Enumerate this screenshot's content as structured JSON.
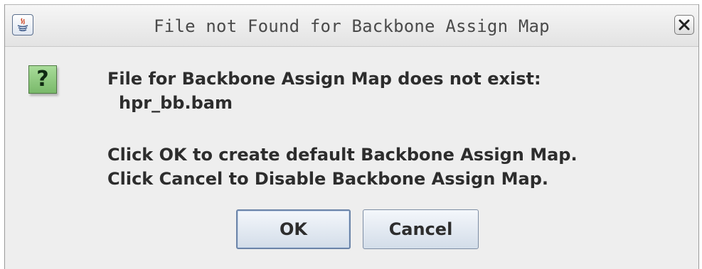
{
  "window": {
    "title": "File not Found for Backbone Assign Map",
    "close_label": "×"
  },
  "message": {
    "icon_glyph": "?",
    "line1": "File for Backbone Assign Map does not exist:",
    "filename": "hpr_bb.bam",
    "line3": "Click OK to create default Backbone Assign Map.",
    "line4": "Click Cancel to Disable Backbone Assign Map."
  },
  "buttons": {
    "ok_label": "OK",
    "cancel_label": "Cancel"
  },
  "icons": {
    "title_icon": "java-app-icon",
    "message_icon": "question-icon",
    "close_icon": "close-icon"
  },
  "colors": {
    "dialog_background": "#eeeeee",
    "question_icon_green": "#8fcb7f",
    "button_border": "#7d8da4"
  }
}
